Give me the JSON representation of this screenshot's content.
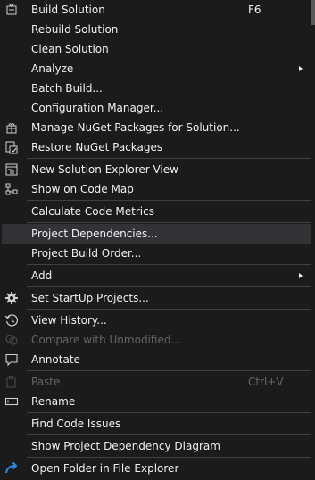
{
  "menu": {
    "items": [
      {
        "label": "Build Solution",
        "shortcut": "F6",
        "icon": "build-solution-icon"
      },
      {
        "label": "Rebuild Solution"
      },
      {
        "label": "Clean Solution"
      },
      {
        "label": "Analyze",
        "submenu": true
      },
      {
        "label": "Batch Build..."
      },
      {
        "label": "Configuration Manager..."
      },
      {
        "label": "Manage NuGet Packages for Solution...",
        "icon": "nuget-package-icon"
      },
      {
        "label": "Restore NuGet Packages",
        "icon": "restore-packages-icon"
      },
      {
        "label": "New Solution Explorer View",
        "icon": "new-explorer-view-icon"
      },
      {
        "label": "Show on Code Map",
        "icon": "code-map-icon"
      },
      {
        "label": "Calculate Code Metrics"
      },
      {
        "label": "Project Dependencies...",
        "highlighted": true
      },
      {
        "label": "Project Build Order..."
      },
      {
        "label": "Add",
        "submenu": true
      },
      {
        "label": "Set StartUp Projects...",
        "icon": "gear-icon"
      },
      {
        "label": "View History...",
        "icon": "history-icon"
      },
      {
        "label": "Compare with Unmodified...",
        "icon": "compare-icon",
        "disabled": true
      },
      {
        "label": "Annotate",
        "icon": "annotate-icon"
      },
      {
        "label": "Paste",
        "shortcut": "Ctrl+V",
        "icon": "paste-icon",
        "disabled": true
      },
      {
        "label": "Rename",
        "icon": "rename-icon"
      },
      {
        "label": "Find Code Issues"
      },
      {
        "label": "Show Project Dependency Diagram"
      },
      {
        "label": "Open Folder in File Explorer",
        "icon": "open-folder-icon"
      }
    ]
  },
  "colors": {
    "background": "#1b1b1c",
    "text": "#f1f1f1",
    "disabled_text": "#656565",
    "hover": "#333337",
    "separator": "#3f3f46",
    "accent_blue": "#2e8be8"
  }
}
